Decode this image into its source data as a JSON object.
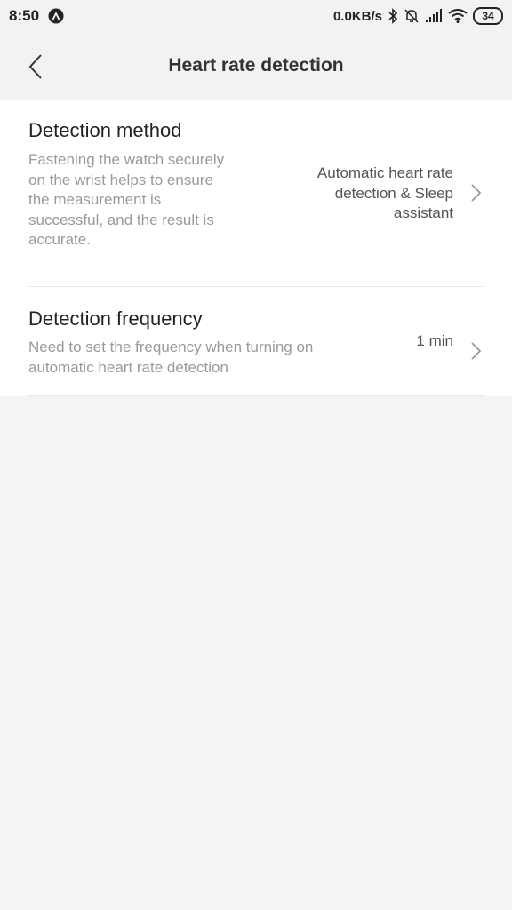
{
  "status_bar": {
    "time": "8:50",
    "network_speed": "0.0KB/s",
    "battery": "34",
    "icons": [
      "app-notification-icon",
      "bluetooth-icon",
      "mute-icon",
      "signal-icon",
      "wifi-icon",
      "battery-icon"
    ]
  },
  "toolbar": {
    "title": "Heart rate detection",
    "back_icon": "chevron-left-icon"
  },
  "settings": [
    {
      "title": "Detection method",
      "description": "Fastening the watch securely on the wrist helps to ensure the measurement is successful, and the result is accurate.",
      "value": "Automatic heart rate detection & Sleep assistant"
    },
    {
      "title": "Detection frequency",
      "description": "Need to set the frequency when turning on automatic heart rate detection",
      "value": "1 min"
    }
  ],
  "colors": {
    "background": "#f4f4f4",
    "card": "#ffffff",
    "title_text": "#222222",
    "description_text": "#9a9a9a"
  }
}
